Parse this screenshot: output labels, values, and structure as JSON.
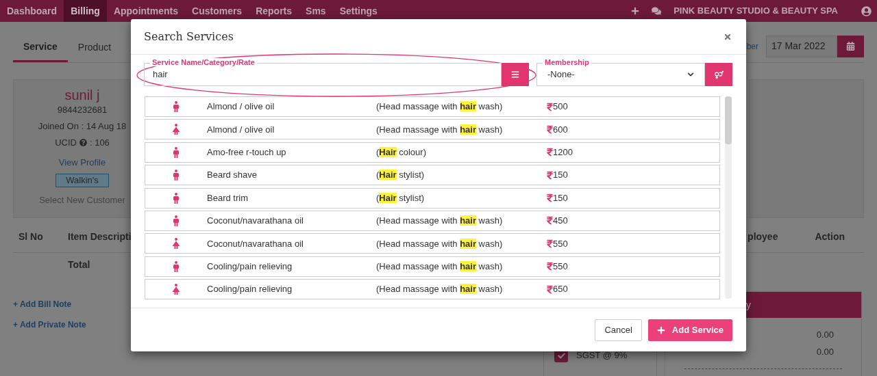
{
  "nav": {
    "items": [
      {
        "label": "Dashboard",
        "selected": false
      },
      {
        "label": "Billing",
        "selected": true
      },
      {
        "label": "Appointments",
        "selected": false
      },
      {
        "label": "Customers",
        "selected": false
      },
      {
        "label": "Reports",
        "selected": false
      },
      {
        "label": "Sms",
        "selected": false
      },
      {
        "label": "Settings",
        "selected": false
      }
    ],
    "brand": "PINK BEAUTY STUDIO & BEAUTY SPA"
  },
  "page": {
    "tabs": [
      {
        "label": "Service",
        "selected": true
      },
      {
        "label": "Product",
        "selected": false
      }
    ],
    "link": "ber",
    "date": "17 Mar 2022",
    "customer": {
      "name": "sunil j",
      "phone": "9844232681",
      "joined": "Joined On : 14 Aug 18",
      "ucid_label": "UCID",
      "ucid_value": ": 106",
      "profile_link": "View Profile",
      "tag": "Walkin's",
      "select_new": "Select New Customer"
    },
    "table_columns": [
      "Sl No",
      "Item Descripti",
      "ployee",
      "Action"
    ],
    "total_label": "Total",
    "notes": [
      "+ Add Bill Note",
      "+ Add Private Note"
    ],
    "tax": {
      "label": "SGST @ 9%",
      "checked": true
    },
    "summary": {
      "title": "y",
      "rows": [
        {
          "value": "0.00"
        },
        {
          "value": "0.00"
        }
      ]
    }
  },
  "modal": {
    "title": "Search Services",
    "search": {
      "label": "Service Name/Category/Rate",
      "value": "hair"
    },
    "membership": {
      "label": "Membership",
      "value": "-None-"
    },
    "results": [
      {
        "kind": "male",
        "name": "Almond / olive oil",
        "before": "(Head massage with ",
        "match": "hair",
        "after": " wash)",
        "price": "500"
      },
      {
        "kind": "female",
        "name": "Almond / olive oil",
        "before": "(Head massage with ",
        "match": "hair",
        "after": " wash)",
        "price": "600"
      },
      {
        "kind": "male",
        "name": "Amo-free r-touch up",
        "before": "(",
        "match": "Hair",
        "after": " colour)",
        "price": "1200"
      },
      {
        "kind": "male",
        "name": "Beard shave",
        "before": "(",
        "match": "Hair",
        "after": " stylist)",
        "price": "150"
      },
      {
        "kind": "male",
        "name": "Beard trim",
        "before": "(",
        "match": "Hair",
        "after": " stylist)",
        "price": "150"
      },
      {
        "kind": "male",
        "name": "Coconut/navarathana oil",
        "before": "(Head massage with ",
        "match": "hair",
        "after": " wash)",
        "price": "450"
      },
      {
        "kind": "female",
        "name": "Coconut/navarathana oil",
        "before": "(Head massage with ",
        "match": "hair",
        "after": " wash)",
        "price": "550"
      },
      {
        "kind": "male",
        "name": "Cooling/pain relieving",
        "before": "(Head massage with ",
        "match": "hair",
        "after": " wash)",
        "price": "550"
      },
      {
        "kind": "female",
        "name": "Cooling/pain relieving",
        "before": "(Head massage with ",
        "match": "hair",
        "after": " wash)",
        "price": "650"
      }
    ],
    "buttons": {
      "cancel": "Cancel",
      "add": "Add Service"
    }
  }
}
